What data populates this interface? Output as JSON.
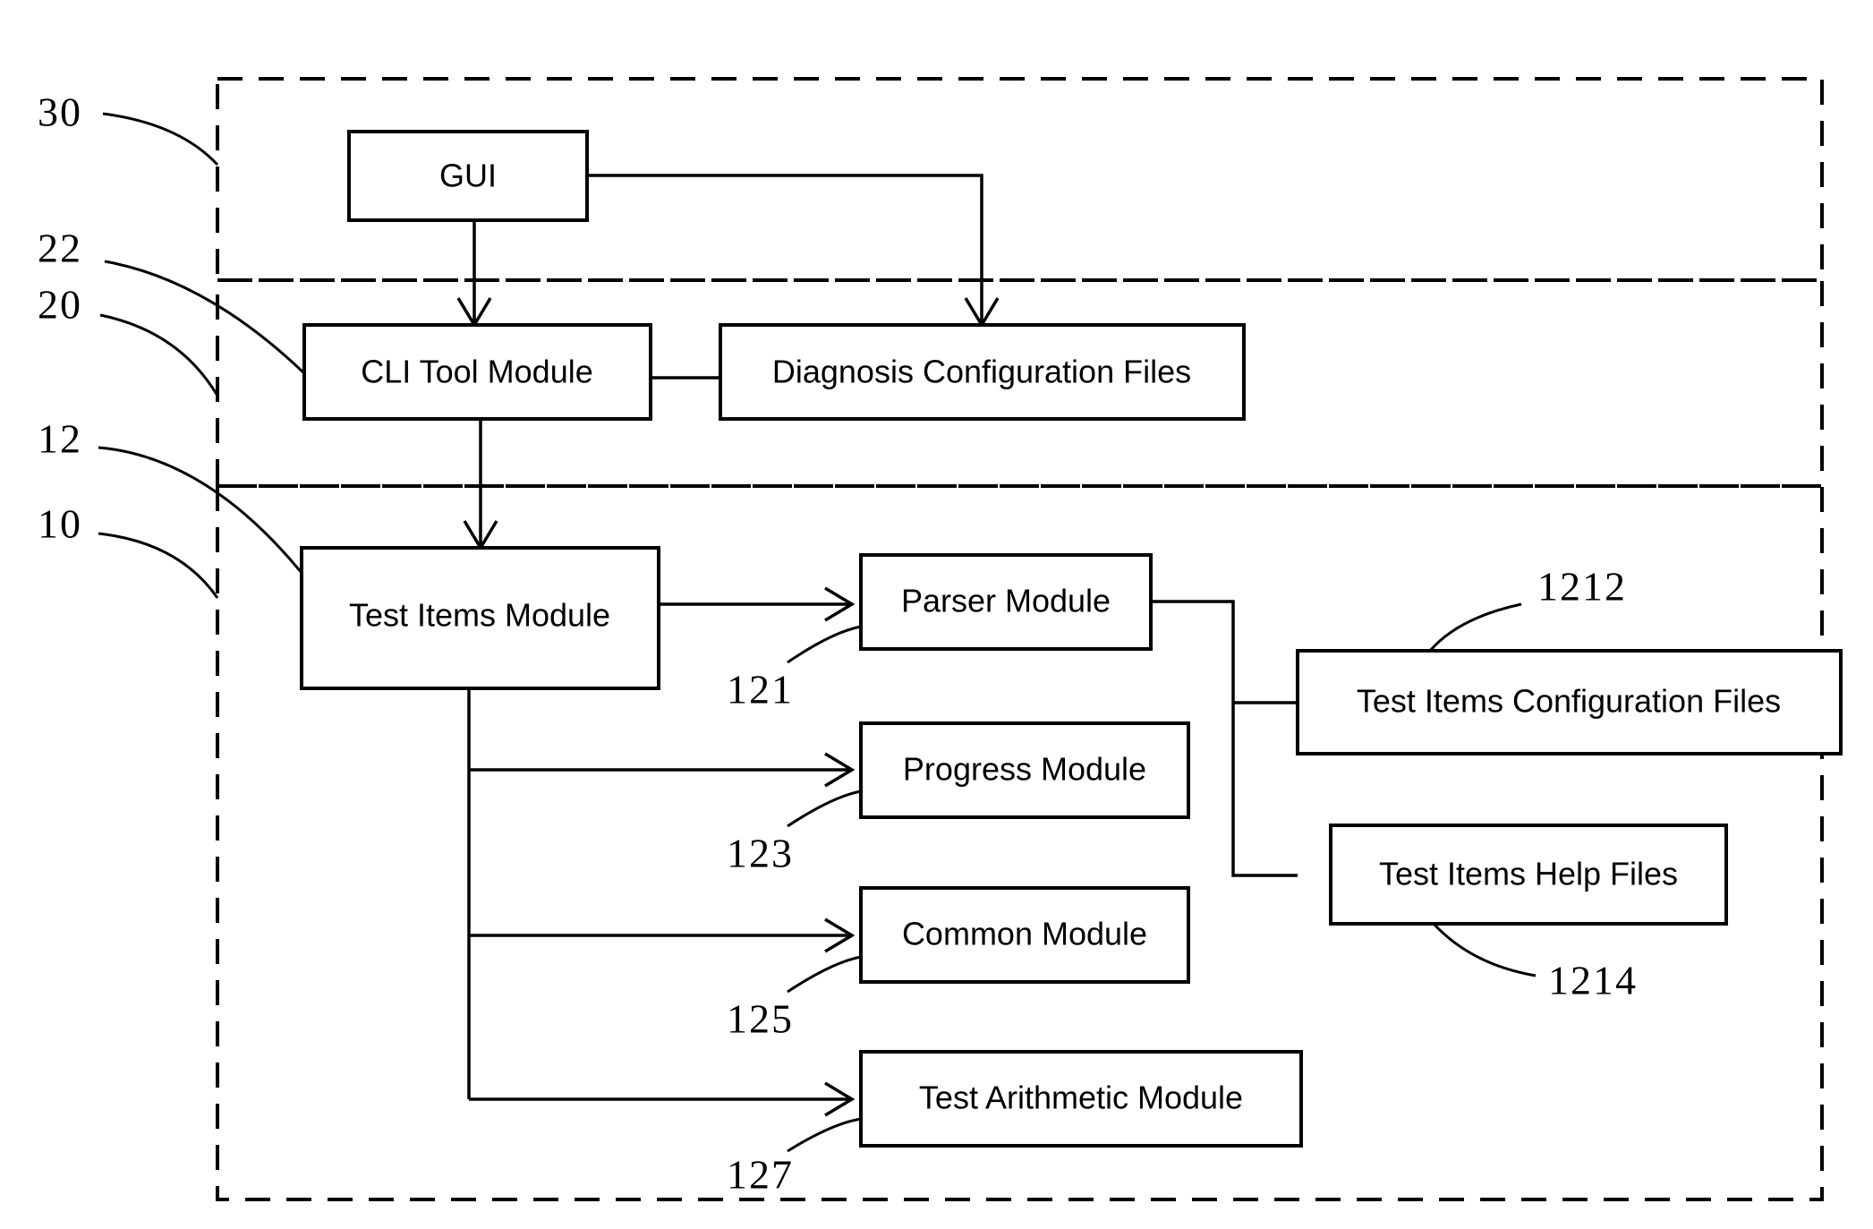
{
  "figure": {
    "type": "patent-block-diagram",
    "background_color": "#ffffff",
    "line_color": "#000000"
  },
  "boxes": {
    "gui": "GUI",
    "cli_tool_module": "CLI Tool Module",
    "diagnosis_configuration_files": "Diagnosis Configuration Files",
    "test_items_module": "Test Items Module",
    "parser_module": "Parser Module",
    "progress_module": "Progress Module",
    "common_module": "Common Module",
    "test_arithmetic_module": "Test Arithmetic Module",
    "test_items_configuration_files": "Test Items Configuration Files",
    "test_items_help_files": "Test Items Help Files"
  },
  "reference_numerals": {
    "gui_region": "30",
    "cli_tool_module": "22",
    "cli_region": "20",
    "test_items_module": "12",
    "test_items_region": "10",
    "parser_module": "121",
    "progress_module": "123",
    "common_module": "125",
    "test_arithmetic_module": "127",
    "test_items_configuration_files": "1212",
    "test_items_help_files": "1214"
  }
}
